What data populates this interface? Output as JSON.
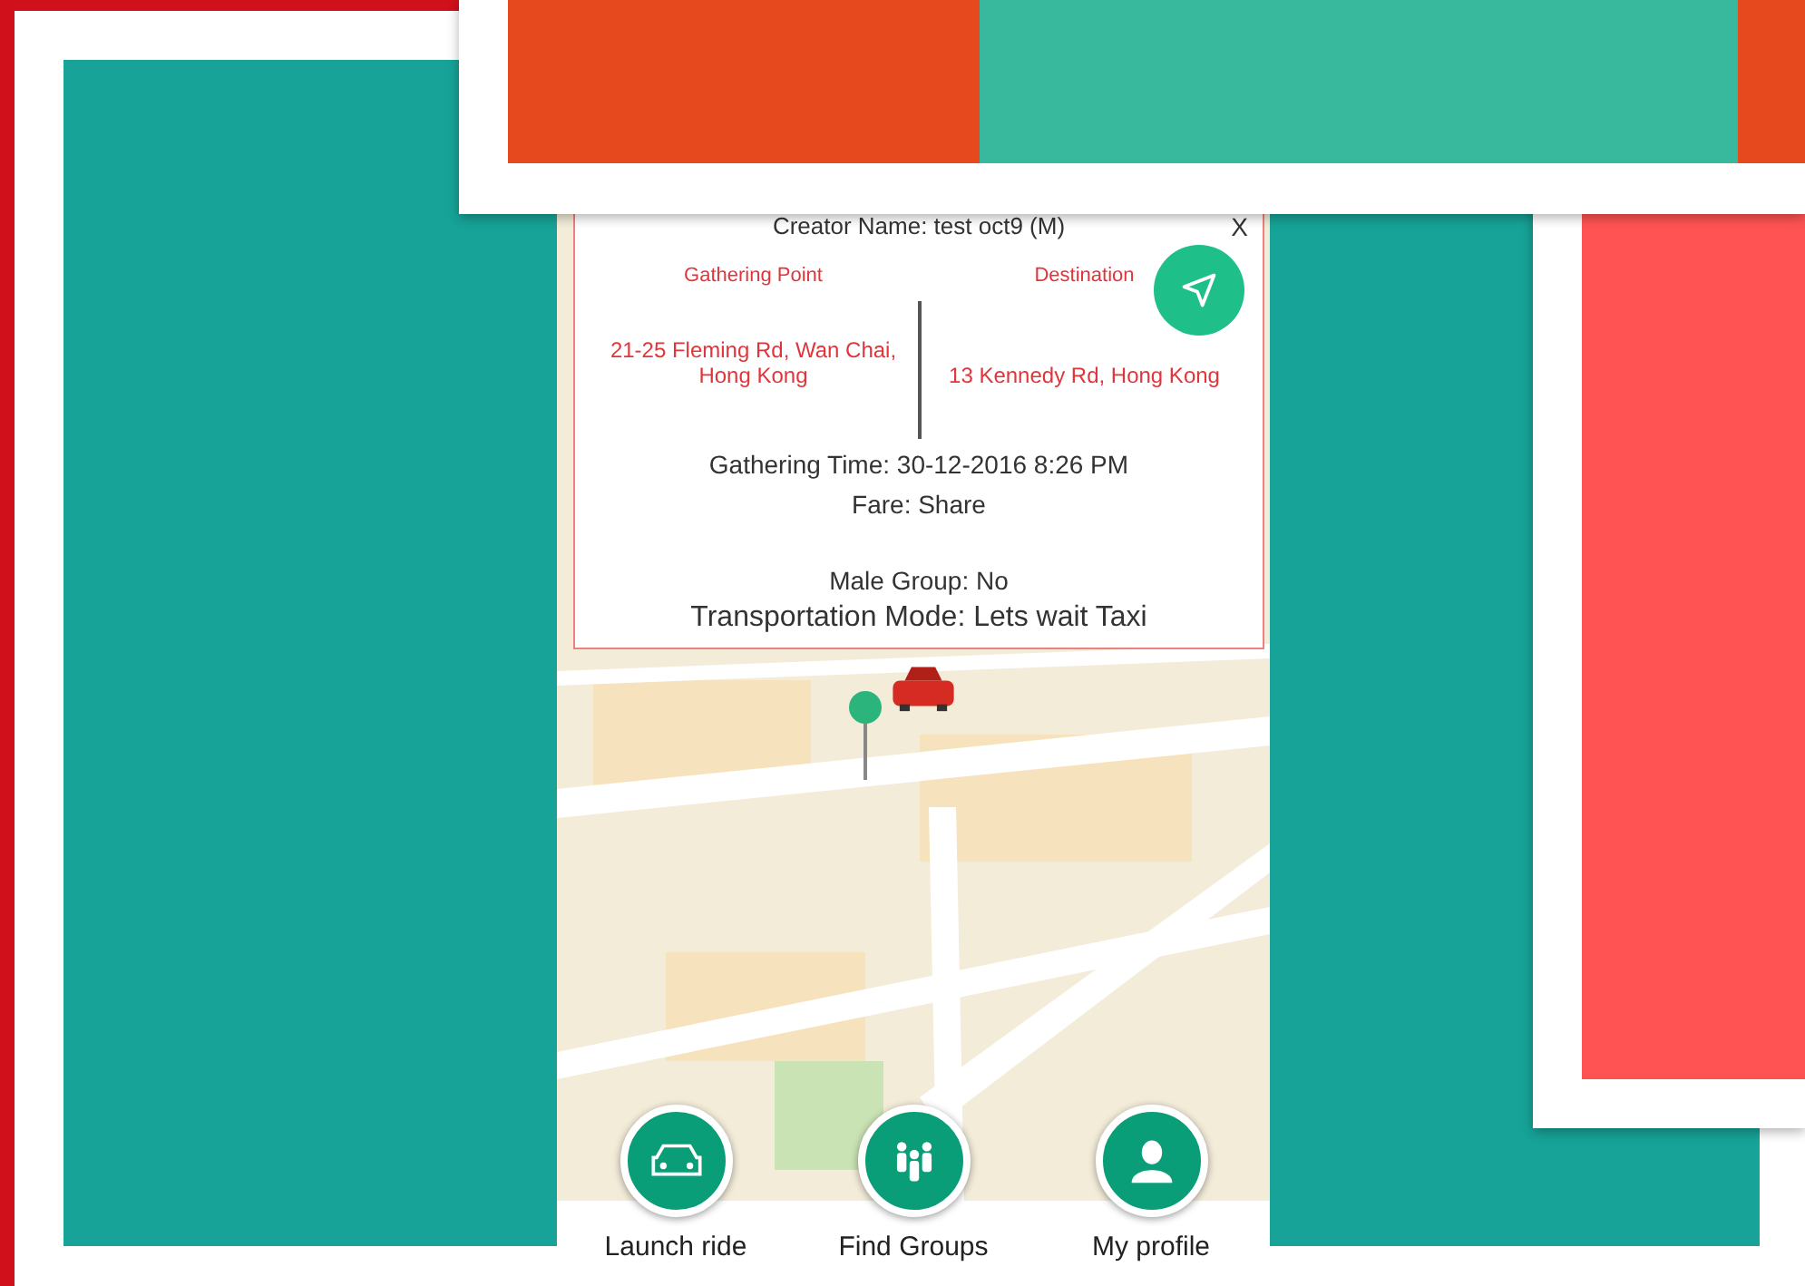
{
  "popup": {
    "creator": "Creator Name: test oct9 (M)",
    "close": "X",
    "gathering_label": "Gathering Point",
    "gathering_address": "21-25 Fleming Rd, Wan Chai, Hong Kong",
    "destination_label": "Destination",
    "destination_address": "13 Kennedy Rd, Hong Kong",
    "details": [
      "Gathering Time: 30-12-2016 8:26 PM",
      "Fare: Share"
    ],
    "male_group": "Male Group: No",
    "transportation": "Transportation Mode: Lets wait Taxi"
  },
  "nav": [
    {
      "kind": "car",
      "label": "Launch ride"
    },
    {
      "kind": "group",
      "label": "Find Groups"
    },
    {
      "kind": "person",
      "label": "My profile"
    }
  ]
}
